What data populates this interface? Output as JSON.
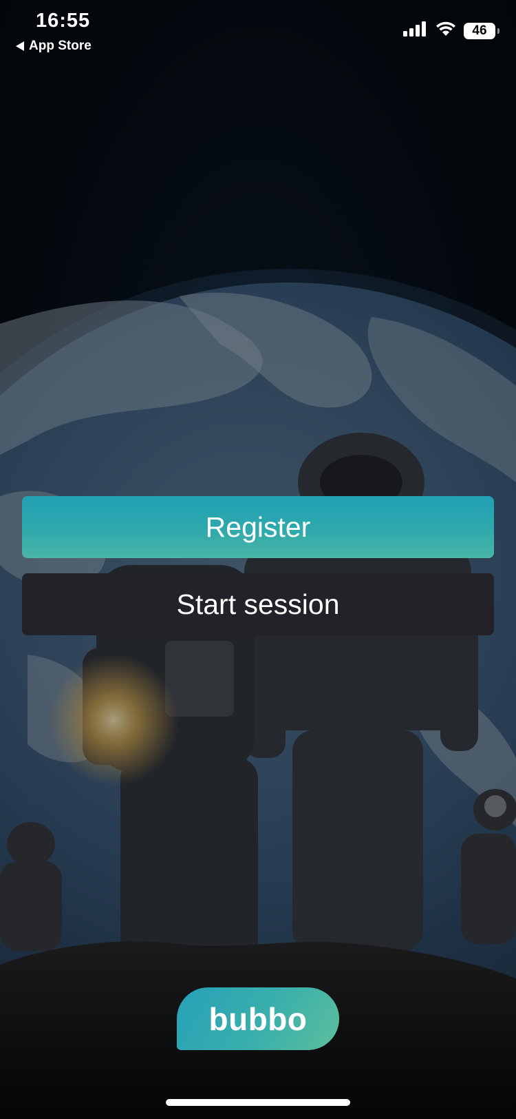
{
  "status_bar": {
    "time": "16:55",
    "back_label": "App Store",
    "battery": "46"
  },
  "actions": {
    "register_label": "Register",
    "start_session_label": "Start session"
  },
  "brand": {
    "logo_text": "bubbo"
  },
  "colors": {
    "accent_teal": "#2ea9ac",
    "accent_green": "#4bb6a4",
    "dark_button": "#222228",
    "background": "#04070b"
  },
  "icons": [
    "back-arrow-icon",
    "signal-icon",
    "wifi-icon",
    "battery-icon"
  ]
}
